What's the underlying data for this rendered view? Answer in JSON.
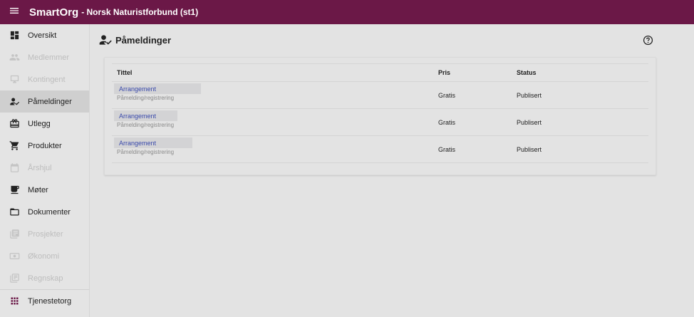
{
  "header": {
    "brand": "SmartOrg",
    "org": "- Norsk Naturistforbund (st1)"
  },
  "sidebar": {
    "items": [
      {
        "label": "Oversikt",
        "icon": "dashboard-icon",
        "state": "normal"
      },
      {
        "label": "Medlemmer",
        "icon": "people-icon",
        "state": "disabled"
      },
      {
        "label": "Kontingent",
        "icon": "monitor-icon",
        "state": "disabled"
      },
      {
        "label": "Påmeldinger",
        "icon": "person-check-icon",
        "state": "active"
      },
      {
        "label": "Utlegg",
        "icon": "receipt-icon",
        "state": "normal"
      },
      {
        "label": "Produkter",
        "icon": "cart-icon",
        "state": "normal"
      },
      {
        "label": "Årshjul",
        "icon": "calendar-icon",
        "state": "disabled"
      },
      {
        "label": "Møter",
        "icon": "coffee-icon",
        "state": "normal"
      },
      {
        "label": "Dokumenter",
        "icon": "folder-icon",
        "state": "normal"
      },
      {
        "label": "Prosjekter",
        "icon": "projects-icon",
        "state": "disabled"
      },
      {
        "label": "Økonomi",
        "icon": "money-icon",
        "state": "disabled"
      },
      {
        "label": "Regnskap",
        "icon": "ledger-icon",
        "state": "disabled"
      }
    ],
    "bottom": {
      "label": "Tjenestetorg",
      "icon": "apps-grid-icon",
      "color": "#6b1847"
    }
  },
  "page": {
    "title": "Påmeldinger",
    "help_icon": "help-icon"
  },
  "table": {
    "columns": [
      "Tittel",
      "Pris",
      "Status"
    ],
    "rows": [
      {
        "title": "Arrangement",
        "subtitle": "Påmelding/registrering",
        "price": "Gratis",
        "status": "Publisert"
      },
      {
        "title": "Arrangement",
        "subtitle": "Påmelding/registrering",
        "price": "Gratis",
        "status": "Publisert"
      },
      {
        "title": "Arrangement",
        "subtitle": "Påmelding/registrering",
        "price": "Gratis",
        "status": "Publisert"
      }
    ]
  },
  "colors": {
    "topbar": "#6b1847",
    "link": "#3949ab",
    "background": "#e3e3e3"
  }
}
